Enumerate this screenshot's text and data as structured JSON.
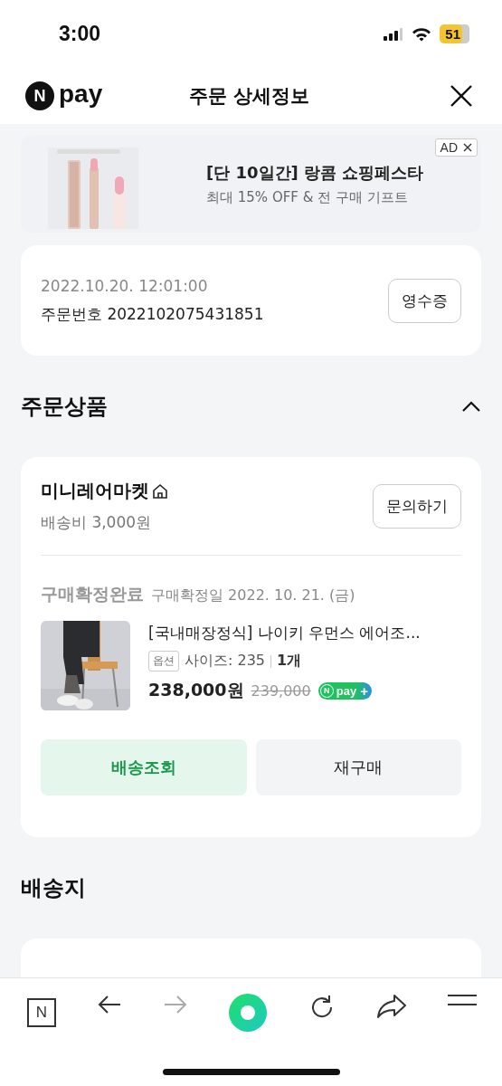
{
  "status_bar": {
    "time": "3:00",
    "battery": "51"
  },
  "header": {
    "logo": {
      "mark": "N",
      "word": "pay"
    },
    "title": "주문 상세정보"
  },
  "ad": {
    "badge": "AD",
    "headline": "[단 10일간] 랑콤 쇼핑페스타",
    "subline": "최대 15% OFF & 전 구매 기프트"
  },
  "order": {
    "datetime": "2022.10.20. 12:01:00",
    "number_label": "주문번호",
    "number": "2022102075431851",
    "receipt_button": "영수증"
  },
  "products_section": {
    "title": "주문상품",
    "expanded": true,
    "seller": {
      "name": "미니레어마켓",
      "shipping": "배송비 3,000원",
      "inquiry_button": "문의하기"
    },
    "status": "구매확정완료",
    "confirm_date": "구매확정일 2022. 10. 21. (금)",
    "item": {
      "name": "[국내매장정식] 나이키 우먼스 에어조...",
      "option_tag": "옵션",
      "option": "사이즈: 235",
      "quantity": "1개",
      "price": "238,000원",
      "original_price": "239,000",
      "badge": {
        "mark": "N",
        "word": "pay",
        "plus": "+"
      }
    },
    "buttons": [
      {
        "label": "배송조회",
        "kind": "primary"
      },
      {
        "label": "재구매",
        "kind": "secondary"
      }
    ]
  },
  "address_section": {
    "title": "배송지"
  },
  "toolbar": [
    {
      "kind": "home",
      "label": "N",
      "disabled": false
    },
    {
      "kind": "back",
      "disabled": false
    },
    {
      "kind": "forward",
      "disabled": true
    },
    {
      "kind": "green",
      "disabled": false
    },
    {
      "kind": "reload",
      "disabled": false
    },
    {
      "kind": "share",
      "disabled": false
    },
    {
      "kind": "menu",
      "disabled": false
    }
  ]
}
